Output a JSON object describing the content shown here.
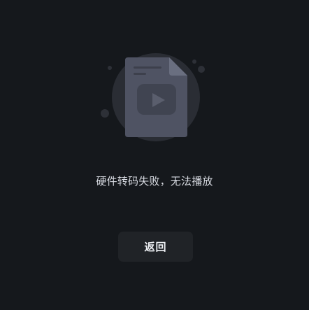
{
  "error": {
    "illustration_icon": "video-file-error-icon",
    "message": "硬件转码失败，无法播放"
  },
  "actions": {
    "back_label": "返回"
  },
  "colors": {
    "background": "#15181c",
    "illustration_circle": "#2a2d34",
    "document": "#4f5363",
    "button_background": "#202327",
    "text": "#d9dce3"
  }
}
